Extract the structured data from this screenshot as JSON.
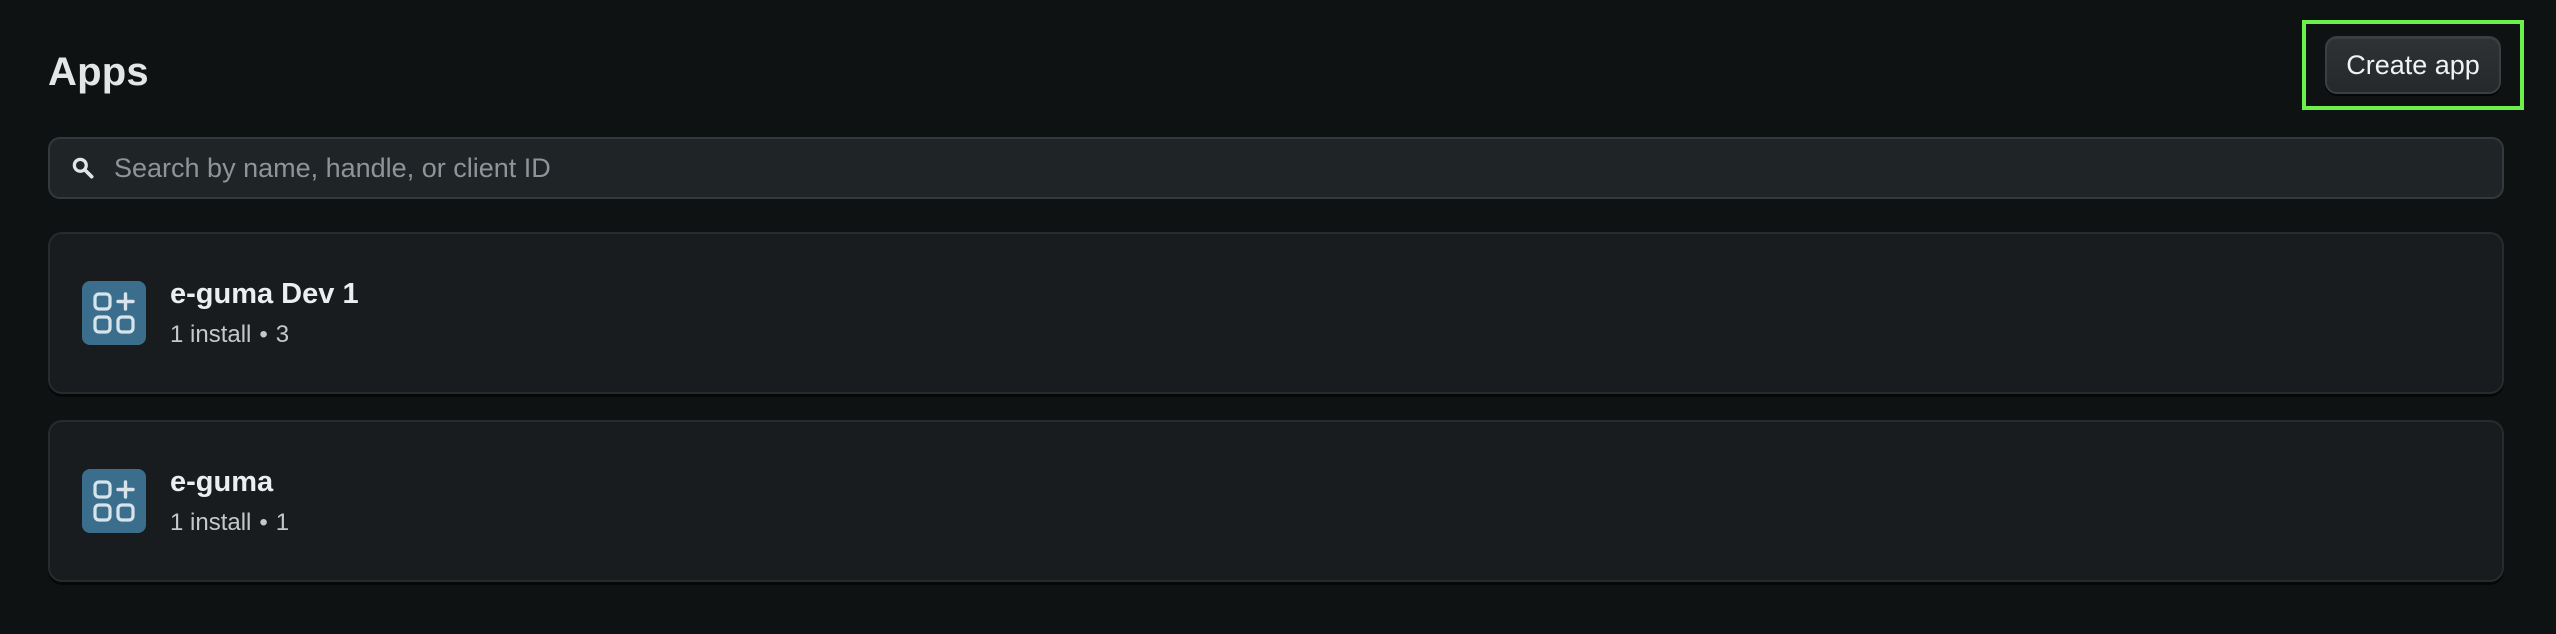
{
  "header": {
    "title": "Apps",
    "create_label": "Create app"
  },
  "search": {
    "placeholder": "Search by name, handle, or client ID",
    "value": ""
  },
  "apps": [
    {
      "name": "e-guma Dev 1",
      "installs": "1 install",
      "separator": "•",
      "count": "3",
      "icon": "app-grid-plus-icon"
    },
    {
      "name": "e-guma",
      "installs": "1 install",
      "separator": "•",
      "count": "1",
      "icon": "app-grid-plus-icon"
    }
  ],
  "colors": {
    "background": "#0e1213",
    "card": "#181c1e",
    "icon_tile": "#3a6e8c",
    "highlight": "#6cf04a"
  }
}
